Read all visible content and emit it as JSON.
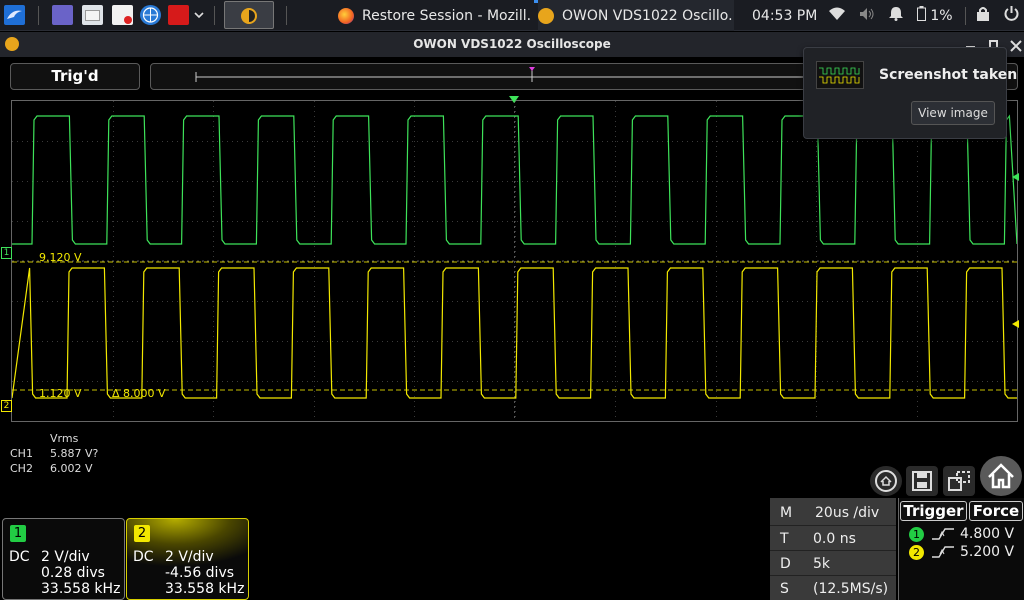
{
  "taskbar": {
    "tasks": [
      {
        "label": "Restore Session - Mozill..."
      },
      {
        "label": "OWON VDS1022 Oscillo..."
      }
    ],
    "clock": "04:53 PM",
    "battery": "1%"
  },
  "window": {
    "title": "OWON VDS1022 Oscilloscope"
  },
  "scope": {
    "status": "Trig'd",
    "cursors": [
      {
        "label": "9.120 V"
      },
      {
        "label": "1.120 V"
      },
      {
        "label": "Δ 8.000 V"
      }
    ],
    "channel_markers": [
      "1",
      "2"
    ]
  },
  "measurements": {
    "header": "Vrms",
    "rows": [
      {
        "ch": "CH1",
        "value": "5.887 V?"
      },
      {
        "ch": "CH2",
        "value": "6.002 V"
      }
    ]
  },
  "channels": [
    {
      "num": "1",
      "coupling": "DC",
      "scale": "2 V/div",
      "offset": "0.28 divs",
      "freq": "33.558 kHz",
      "color": "#22cc44"
    },
    {
      "num": "2",
      "coupling": "DC",
      "scale": "2 V/div",
      "offset": "-4.56 divs",
      "freq": "33.558 kHz",
      "color": "#e8e000"
    }
  ],
  "timebase": [
    {
      "key": "M",
      "value": "20us /div"
    },
    {
      "key": "T",
      "value": "0.0 ns"
    },
    {
      "key": "D",
      "value": "5k"
    },
    {
      "key": "S",
      "value": "(12.5MS/s)"
    }
  ],
  "trigger": {
    "trigger_label": "Trigger",
    "force_label": "Force",
    "levels": [
      {
        "ch": "1",
        "value": "4.800 V",
        "color": "#22cc44"
      },
      {
        "ch": "2",
        "value": "5.200 V",
        "color": "#e8e000"
      }
    ]
  },
  "notification": {
    "title": "Screenshot taken",
    "button": "View image"
  }
}
